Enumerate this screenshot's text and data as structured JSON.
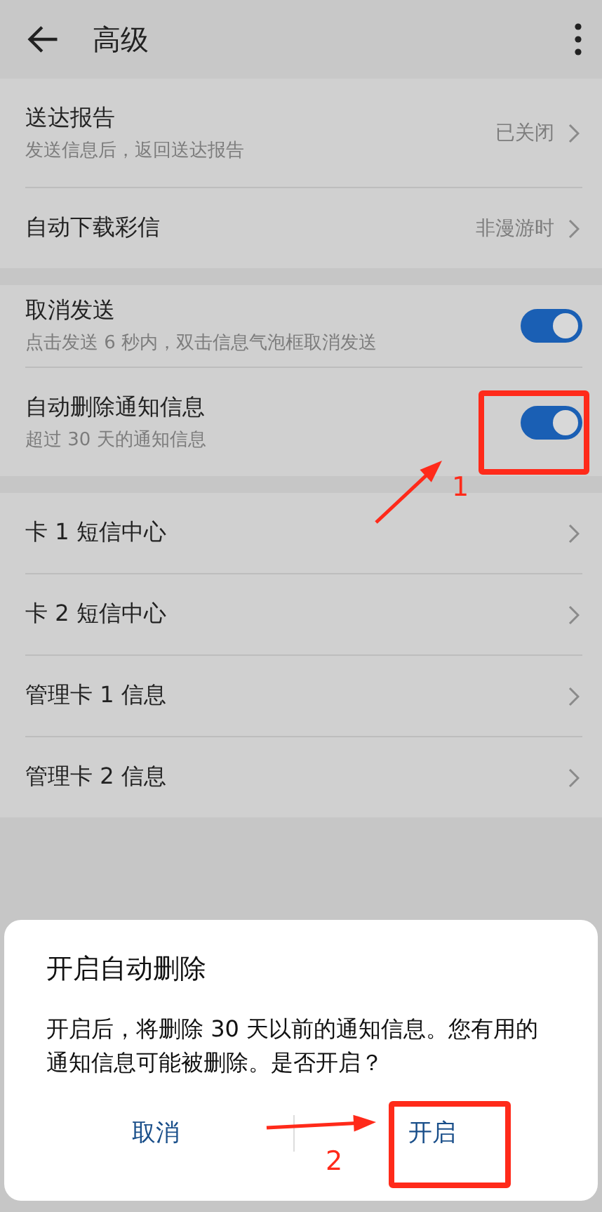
{
  "header": {
    "title": "高级"
  },
  "sections": [
    {
      "items": [
        {
          "kind": "link",
          "title": "送达报告",
          "subtitle": "发送信息后，返回送达报告",
          "value": "已关闭"
        },
        {
          "kind": "link",
          "title": "自动下载彩信",
          "value": "非漫游时"
        }
      ]
    },
    {
      "items": [
        {
          "kind": "toggle",
          "title": "取消发送",
          "subtitle": "点击发送 6 秒内，双击信息气泡框取消发送",
          "on": true
        },
        {
          "kind": "toggle",
          "title": "自动删除通知信息",
          "subtitle": "超过 30 天的通知信息",
          "on": true
        }
      ]
    },
    {
      "items": [
        {
          "kind": "link",
          "title": "卡 1 短信中心"
        },
        {
          "kind": "link",
          "title": "卡 2 短信中心"
        },
        {
          "kind": "link",
          "title": "管理卡 1 信息"
        },
        {
          "kind": "link",
          "title": "管理卡 2 信息"
        }
      ]
    }
  ],
  "dialog": {
    "title": "开启自动删除",
    "message": "开启后，将删除 30 天以前的通知信息。您有用的通知信息可能被删除。是否开启？",
    "buttons": [
      {
        "label": "取消"
      },
      {
        "label": "开启"
      }
    ]
  },
  "annotations": [
    {
      "number": "1"
    },
    {
      "number": "2"
    }
  ]
}
